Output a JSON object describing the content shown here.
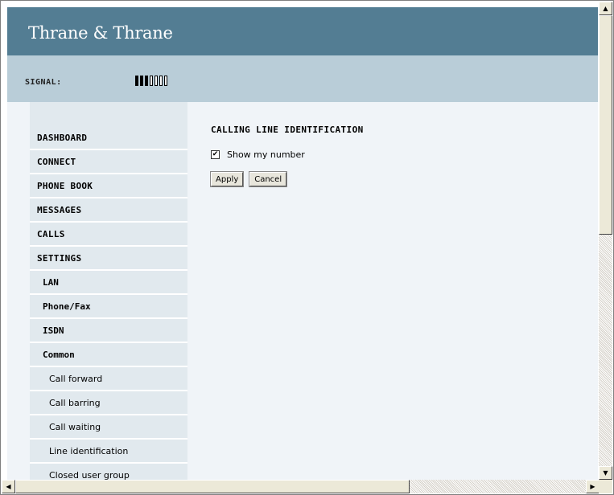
{
  "header": {
    "brand": "Thrane & Thrane"
  },
  "signal": {
    "label": "SIGNAL:",
    "level_filled": 3,
    "level_total": 7
  },
  "nav": {
    "items": [
      {
        "label": "DASHBOARD",
        "level": 1
      },
      {
        "label": "CONNECT",
        "level": 1
      },
      {
        "label": "PHONE BOOK",
        "level": 1
      },
      {
        "label": "MESSAGES",
        "level": 1
      },
      {
        "label": "CALLS",
        "level": 1
      },
      {
        "label": "SETTINGS",
        "level": 1
      },
      {
        "label": "LAN",
        "level": 2
      },
      {
        "label": "Phone/Fax",
        "level": 2
      },
      {
        "label": "ISDN",
        "level": 2
      },
      {
        "label": "Common",
        "level": 2
      },
      {
        "label": "Call forward",
        "level": 3
      },
      {
        "label": "Call barring",
        "level": 3
      },
      {
        "label": "Call waiting",
        "level": 3
      },
      {
        "label": "Line identification",
        "level": 3
      },
      {
        "label": "Closed user group",
        "level": 3
      }
    ]
  },
  "main": {
    "title": "CALLING LINE IDENTIFICATION",
    "checkbox": {
      "label": "Show my number",
      "checked": true
    },
    "apply_label": "Apply",
    "cancel_label": "Cancel"
  },
  "colors": {
    "header": "#537d93",
    "signal_bar": "#b9cdd8",
    "sidebar": "#e1e9ee",
    "page": "#f0f4f8"
  }
}
